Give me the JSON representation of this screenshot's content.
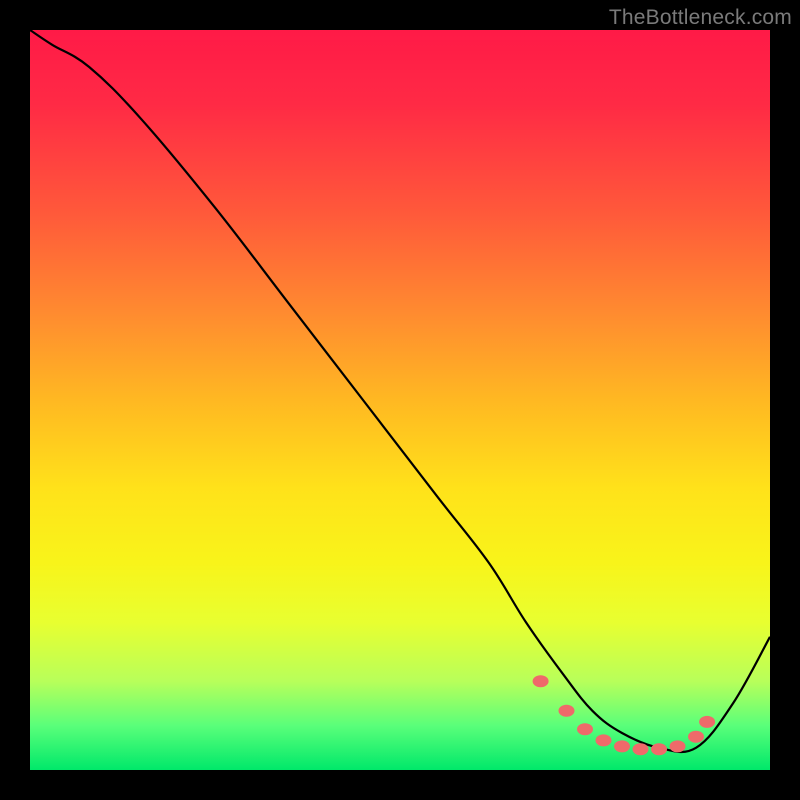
{
  "watermark": "TheBottleneck.com",
  "colors": {
    "frame": "#000000",
    "gradient_top": "#ff1a47",
    "gradient_bottom": "#00e86a",
    "curve": "#000000",
    "dots": "#ef6a6a"
  },
  "chart_data": {
    "type": "line",
    "title": "",
    "xlabel": "",
    "ylabel": "",
    "xlim": [
      0,
      100
    ],
    "ylim": [
      0,
      100
    ],
    "grid": false,
    "note": "No axes or ticks are rendered; values are read off as percentage of plot width (x) and height (y, 0 at bottom).",
    "series": [
      {
        "name": "curve",
        "x": [
          0,
          3,
          8,
          15,
          25,
          35,
          45,
          55,
          62,
          67,
          72,
          76,
          80,
          85,
          90,
          95,
          100
        ],
        "y": [
          100,
          98,
          95,
          88,
          76,
          63,
          50,
          37,
          28,
          20,
          13,
          8,
          5,
          3,
          3,
          9,
          18
        ]
      }
    ],
    "markers": {
      "name": "highlight-dots",
      "x": [
        69,
        72.5,
        75,
        77.5,
        80,
        82.5,
        85,
        87.5,
        90,
        91.5
      ],
      "y": [
        12,
        8,
        5.5,
        4,
        3.2,
        2.8,
        2.8,
        3.2,
        4.5,
        6.5
      ]
    }
  }
}
